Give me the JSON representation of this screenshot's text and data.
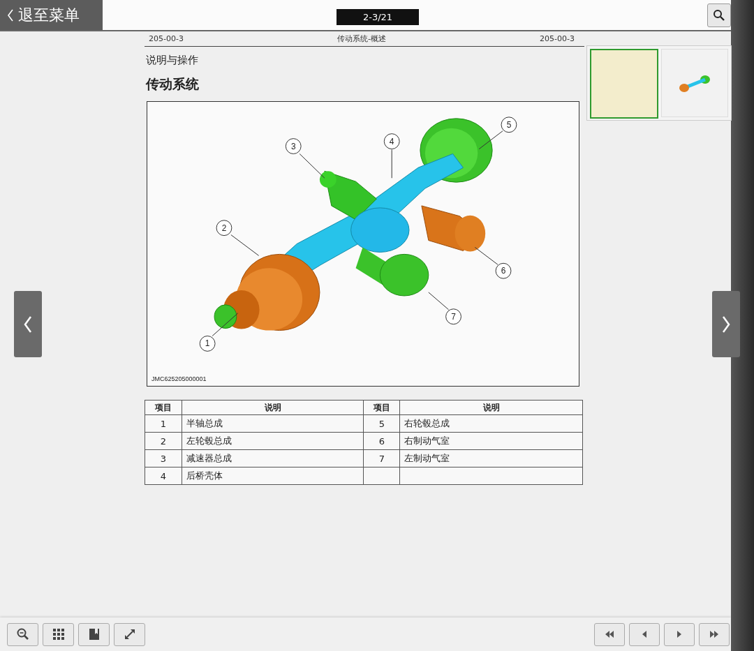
{
  "top_bar": {
    "back_button": "退至菜单",
    "page_indicator": "2-3/21"
  },
  "page": {
    "header": {
      "left": "205-00-3",
      "center": "传动系统-概述",
      "right": "205-00-3"
    },
    "section": "说明与操作",
    "title": "传动系统",
    "figure": {
      "callouts": [
        "1",
        "2",
        "3",
        "4",
        "5",
        "6",
        "7"
      ],
      "figure_code": "JMC625205000001"
    },
    "table": {
      "columns": [
        "项目",
        "说明",
        "项目",
        "说明"
      ],
      "rows": [
        {
          "cells": [
            "1",
            "半轴总成",
            "5",
            "右轮毂总成"
          ]
        },
        {
          "cells": [
            "2",
            "左轮毂总成",
            "6",
            "右制动气室"
          ]
        },
        {
          "cells": [
            "3",
            "减速器总成",
            "7",
            "左制动气室"
          ]
        },
        {
          "cells": [
            "4",
            "后桥壳体"
          ]
        }
      ]
    }
  },
  "thumbnails": [
    {
      "selected": true
    },
    {
      "selected": false
    }
  ]
}
